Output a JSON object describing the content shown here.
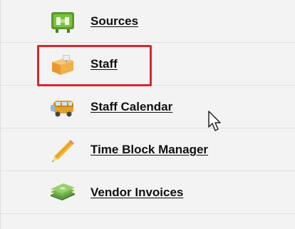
{
  "menu": {
    "items": [
      {
        "label": "Sources",
        "icon": "sources-sign-icon"
      },
      {
        "label": "Staff",
        "icon": "staff-desk-icon"
      },
      {
        "label": "Staff Calendar",
        "icon": "staff-calendar-bus-icon"
      },
      {
        "label": "Time Block Manager",
        "icon": "pencil-icon"
      },
      {
        "label": "Vendor Invoices",
        "icon": "money-stack-icon"
      }
    ],
    "highlighted_item": "Staff"
  },
  "colors": {
    "highlight_border": "#d9262e",
    "panel_background": "#f3f3f3",
    "link_text": "#101010"
  }
}
